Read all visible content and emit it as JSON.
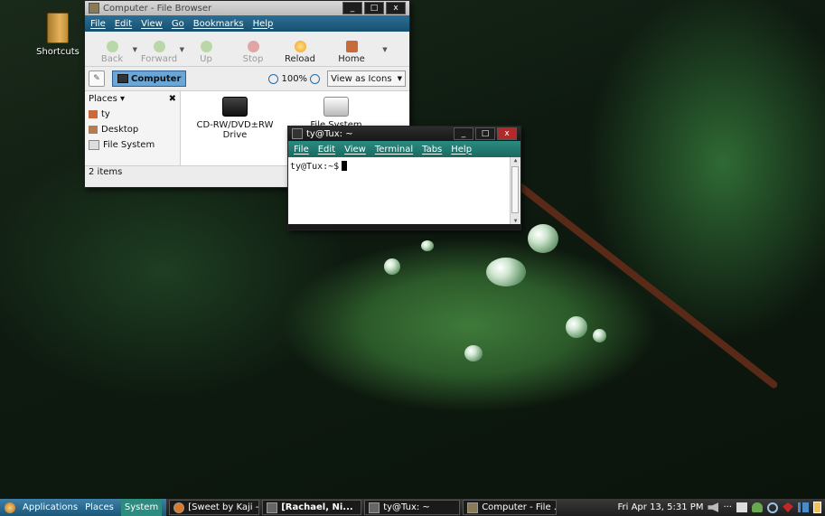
{
  "desktop": {
    "shortcuts_label": "Shortcuts"
  },
  "file_browser": {
    "title": "Computer - File Browser",
    "menu": [
      "File",
      "Edit",
      "View",
      "Go",
      "Bookmarks",
      "Help"
    ],
    "toolbar": {
      "back": "Back",
      "forward": "Forward",
      "up": "Up",
      "stop": "Stop",
      "reload": "Reload",
      "home": "Home"
    },
    "location": {
      "path_button": "Computer",
      "zoom": "100%",
      "view_as": "View as Icons"
    },
    "sidebar": {
      "header": "Places",
      "items": [
        "ty",
        "Desktop",
        "File System"
      ]
    },
    "items": [
      {
        "label_line1": "CD-RW/DVD±RW",
        "label_line2": "Drive"
      },
      {
        "label_line1": "File System",
        "label_line2": ""
      }
    ],
    "status": "2 items"
  },
  "terminal": {
    "title": "ty@Tux: ~",
    "menu": [
      "File",
      "Edit",
      "View",
      "Terminal",
      "Tabs",
      "Help"
    ],
    "prompt": "ty@Tux:~$"
  },
  "panel": {
    "menus": {
      "applications": "Applications",
      "places": "Places",
      "system": "System"
    },
    "tasks": [
      "[Sweet by Kaji - ...",
      "[Rachael, Ni...",
      "ty@Tux: ~",
      "Computer - File ..."
    ],
    "clock": "Fri Apr 13,  5:31 PM"
  },
  "window_buttons": {
    "minimize": "_",
    "maximize": "□",
    "close": "x"
  },
  "colors": {
    "menubar_fb": "#1f5f84",
    "menubar_term": "#237a70",
    "panel": "#2a2a2a"
  }
}
